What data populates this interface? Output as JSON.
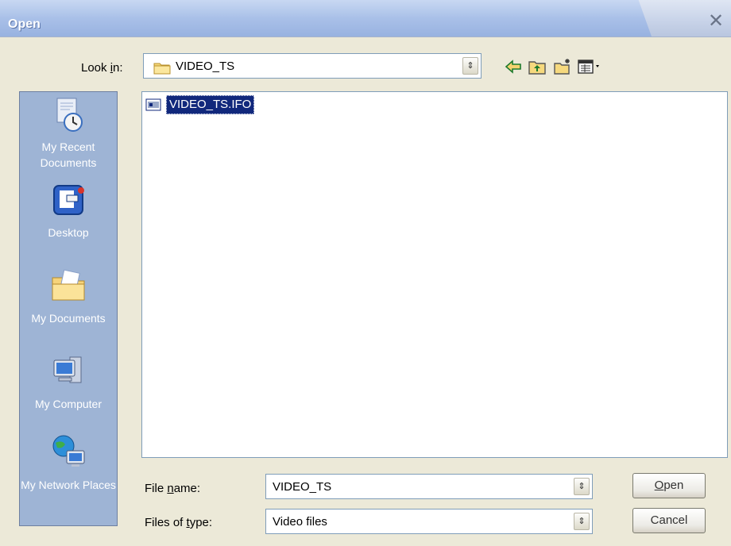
{
  "window": {
    "title": "Open",
    "close_glyph": "✕"
  },
  "lookin": {
    "label_pre": "Look ",
    "label_accel": "i",
    "label_post": "n:",
    "value": "VIDEO_TS"
  },
  "toolbar": {
    "back": "back-icon",
    "up": "up-folder-icon",
    "newfolder": "new-folder-icon",
    "views": "views-menu-icon"
  },
  "places": [
    {
      "label": "My Recent Documents",
      "icon": "recent-documents-icon"
    },
    {
      "label": "Desktop",
      "icon": "desktop-icon"
    },
    {
      "label": "My Documents",
      "icon": "my-documents-icon"
    },
    {
      "label": "My Computer",
      "icon": "my-computer-icon"
    },
    {
      "label": "My Network Places",
      "icon": "network-places-icon"
    }
  ],
  "files": [
    {
      "name": "VIDEO_TS.IFO",
      "icon": "ifo-file-icon",
      "selected": true
    }
  ],
  "filename": {
    "label_pre": "File ",
    "label_accel": "n",
    "label_post": "ame:",
    "value": "VIDEO_TS"
  },
  "filetype": {
    "label_pre": "Files of ",
    "label_accel": "t",
    "label_post": "ype:",
    "value": "Video files"
  },
  "buttons": {
    "open_accel": "O",
    "open_rest": "pen",
    "cancel": "Cancel"
  },
  "colors": {
    "selection": "#11287c",
    "places_bg": "#9eb4d5",
    "dialog_bg": "#ece9d8"
  }
}
